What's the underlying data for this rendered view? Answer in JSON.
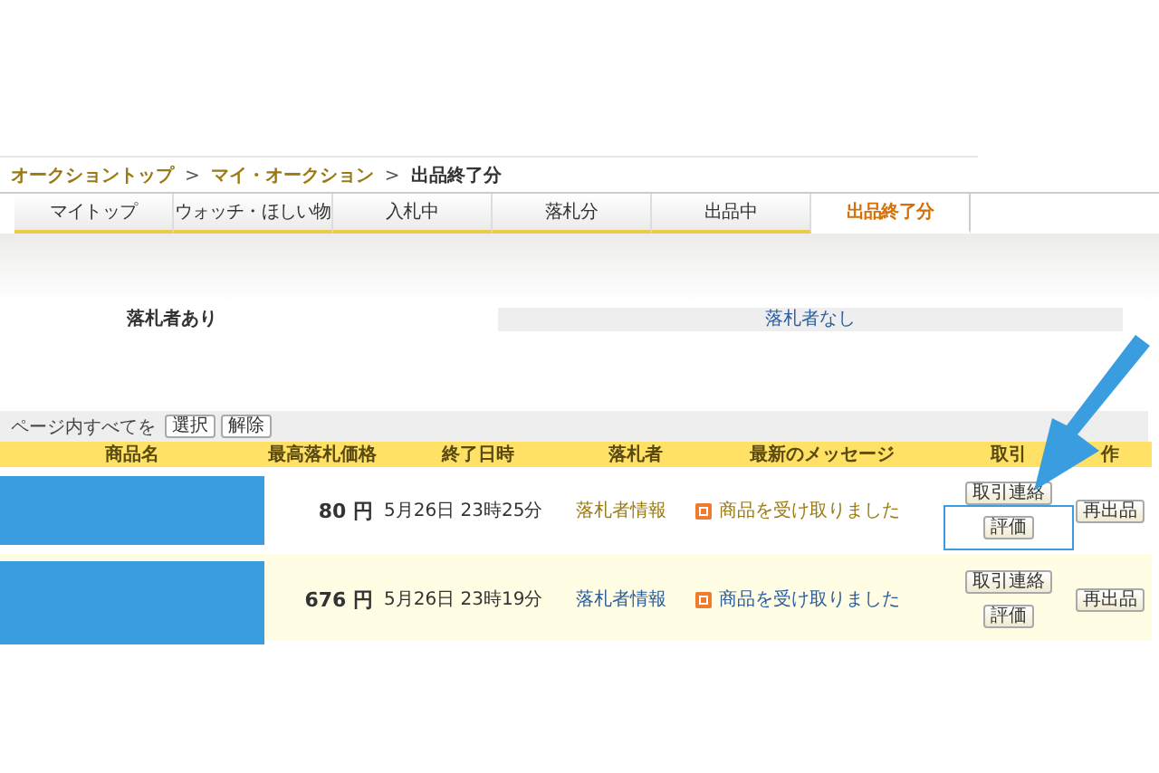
{
  "breadcrumbs": [
    {
      "label": "オークショントップ",
      "link": true
    },
    {
      "label": "マイ・オークション",
      "link": true
    },
    {
      "label": "出品終了分",
      "link": false
    }
  ],
  "breadcrumb_separator": ">",
  "tabs": [
    {
      "label": "マイトップ",
      "selected": false
    },
    {
      "label": "ウォッチ・ほしい物",
      "selected": false
    },
    {
      "label": "入札中",
      "selected": false
    },
    {
      "label": "落札分",
      "selected": false
    },
    {
      "label": "出品中",
      "selected": false
    },
    {
      "label": "出品終了分",
      "selected": true
    }
  ],
  "filter_tabs": [
    {
      "label": "落札者あり",
      "selected": true
    },
    {
      "label": "落札者なし",
      "selected": false
    }
  ],
  "bulk_select": {
    "label": "ページ内すべてを",
    "buttons": [
      "選択",
      "解除"
    ]
  },
  "table": {
    "columns": [
      "商品名",
      "最高落札価格",
      "終了日時",
      "落札者",
      "最新のメッセージ",
      "取引",
      "作"
    ],
    "rows": [
      {
        "redacted": true,
        "price": "80 円",
        "end_time": "5月26日 23時25分",
        "winner": "落札者情報",
        "message": "商品を受け取りました",
        "visited": true,
        "trade_buttons": [
          "取引連絡",
          "評価"
        ],
        "action_button": "再出品",
        "highlighted": true,
        "pointer_arrow": true
      },
      {
        "redacted": true,
        "price": "676 円",
        "end_time": "5月26日 23時19分",
        "winner": "落札者情報",
        "message": "商品を受け取りました",
        "visited": false,
        "trade_buttons": [
          "取引連絡",
          "評価"
        ],
        "action_button": "再出品",
        "highlighted": false,
        "pointer_arrow": false
      }
    ]
  }
}
